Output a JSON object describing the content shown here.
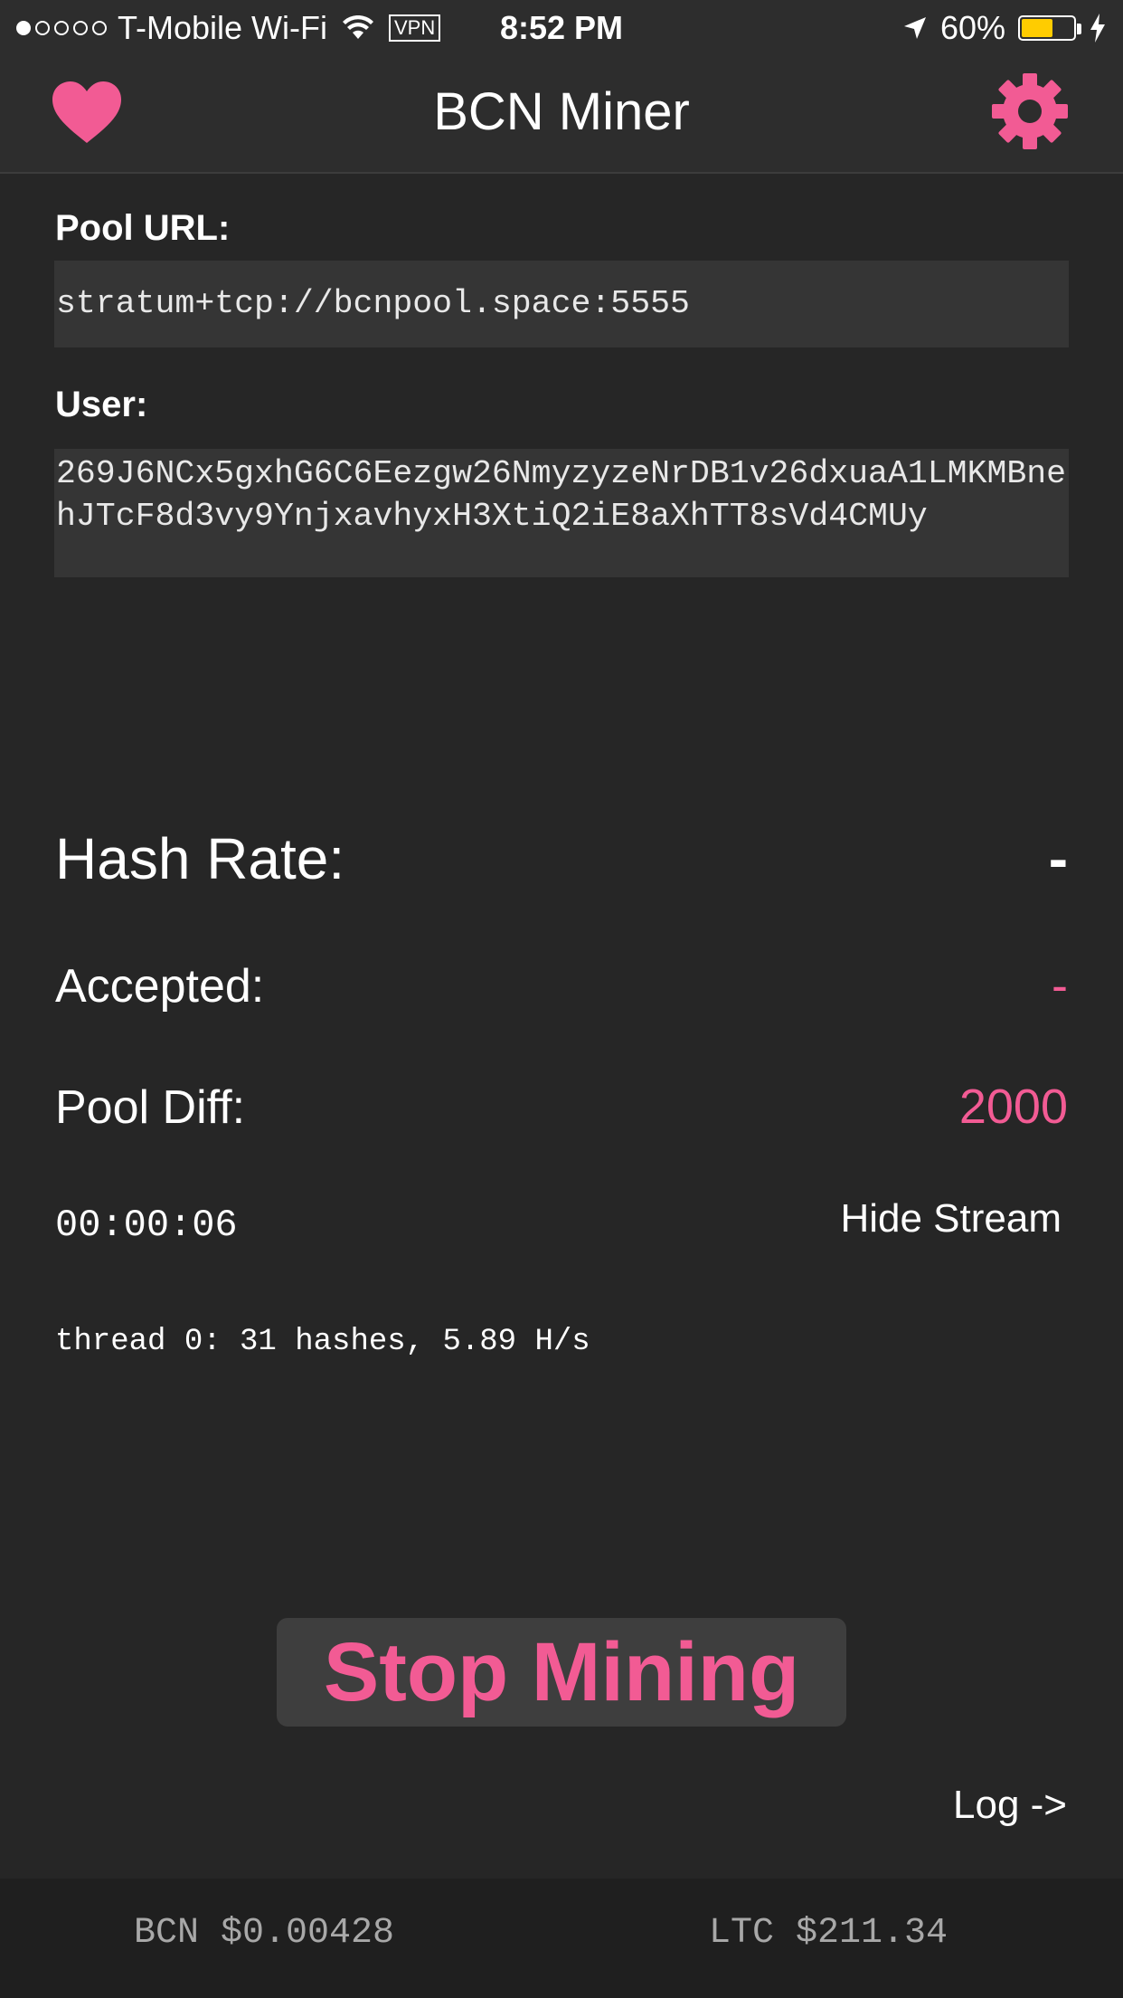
{
  "status_bar": {
    "carrier": "T-Mobile Wi-Fi",
    "vpn": "VPN",
    "time": "8:52 PM",
    "battery": "60%",
    "battery_level": 0.6,
    "battery_color": "#ffcc00"
  },
  "nav": {
    "title": "BCN Miner",
    "left_icon": "heart-icon",
    "right_icon": "gear-icon",
    "accent": "#f25b94"
  },
  "form": {
    "pool_url_label": "Pool URL:",
    "pool_url_value": "stratum+tcp://bcnpool.space:5555",
    "user_label": "User:",
    "user_value": "269J6NCx5gxhG6C6Eezgw26NmyzyzeNrDB1v26dxuaA1LMKMBnehJTcF8d3vy9YnjxavhyxH3XtiQ2iE8aXhTT8sVd4CMUy"
  },
  "stats": {
    "hash_rate_label": "Hash Rate:",
    "hash_rate_value": "-",
    "accepted_label": "Accepted:",
    "accepted_value": "-",
    "pool_diff_label": "Pool Diff:",
    "pool_diff_value": "2000"
  },
  "stream": {
    "timer": "00:00:06",
    "toggle_label": "Hide Stream",
    "lines": [
      "thread 0: 31 hashes, 5.89 H/s"
    ]
  },
  "actions": {
    "stop_label": "Stop Mining",
    "log_label": "Log ->"
  },
  "footer": {
    "bcn": "BCN $0.00428",
    "ltc": "LTC $211.34"
  }
}
